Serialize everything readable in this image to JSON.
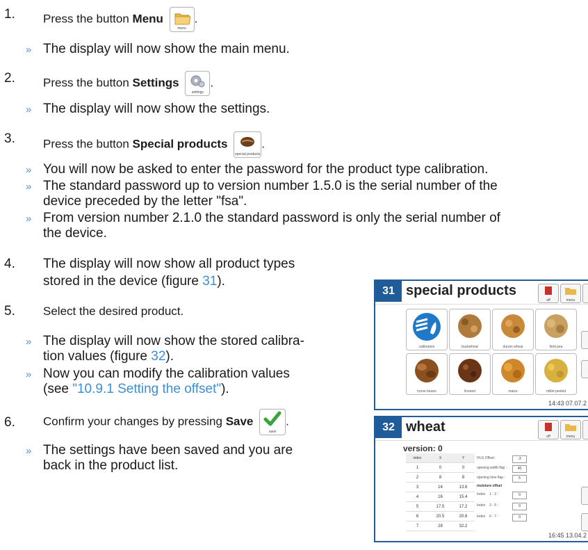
{
  "steps": [
    {
      "number": "1.",
      "text": "Press the button ",
      "bold": "Menu",
      "icon": "folder-icon",
      "icon_caption": "menu",
      "suffix": "."
    },
    {
      "number": "2.",
      "text": "Press the button ",
      "bold": "Settings",
      "icon": "gear-icon",
      "icon_caption": "settings",
      "suffix": "."
    },
    {
      "number": "3.",
      "text": "Press the button ",
      "bold": "Special products",
      "icon": "grain-icon",
      "icon_caption": "special products",
      "suffix": "."
    },
    {
      "number": "4.",
      "line1": "The display will now show all product types",
      "line2_a": "stored in the device (figure ",
      "line2_link": "31",
      "line2_b": ")."
    },
    {
      "number": "5.",
      "text": "Select the desired product."
    },
    {
      "number": "6.",
      "text": "Confirm your changes by pressing ",
      "bold": "Save",
      "icon": "checkmark-icon",
      "icon_caption": "save",
      "suffix": "."
    }
  ],
  "results": {
    "r1": "The display will now show the main menu.",
    "r2": "The display will now show the settings.",
    "r3a": "You will now be asked to enter the password for the product type calibration.",
    "r3b_1": "The standard password up to version number 1.5.0 is the serial number of the",
    "r3b_2": "device preceded by the letter \"fsa\".",
    "r3c_1": "From version number 2.1.0 the standard password is only the serial number of",
    "r3c_2": "the device.",
    "r5a_1": "The display will now show the stored calibra-",
    "r5a_2a": "tion values (figure ",
    "r5a_2link": "32",
    "r5a_2b": ").",
    "r5b_1": "Now you can modify the calibration values",
    "r5b_2a": "(see ",
    "r5b_2link": "\"10.9.1 Setting the offset\"",
    "r5b_2b": ").",
    "r6_1": "The settings have been saved and you are",
    "r6_2": "back in the product list.",
    "arrow": "»"
  },
  "figure31": {
    "number": "31",
    "title": "special products",
    "buttons": [
      {
        "caption": "off"
      },
      {
        "caption": "menu"
      }
    ],
    "tiles": [
      "calibration",
      "buckwheat",
      "durum wheat",
      "field pea",
      "horse beans",
      "linseed",
      "maize",
      "millet peeled"
    ],
    "clock": "14:43 07.07.2"
  },
  "figure32": {
    "number": "32",
    "title": "wheat",
    "buttons": [
      {
        "caption": "off"
      },
      {
        "caption": "menu"
      }
    ],
    "version": "version: 0",
    "table_headers": [
      "index",
      "X",
      "Y"
    ],
    "table_rows": [
      [
        "1",
        "0",
        "0"
      ],
      [
        "2",
        "8",
        "8"
      ],
      [
        "3",
        "14",
        "13.6"
      ],
      [
        "4",
        "16",
        "15.4"
      ],
      [
        "5",
        "17.5",
        "17.2"
      ],
      [
        "6",
        "20.5",
        "20.8"
      ],
      [
        "7",
        "28",
        "32.2"
      ]
    ],
    "params": [
      {
        "label": "HLG Offset :",
        "value": "-3"
      },
      {
        "label": "opening width flap :",
        "value": "40"
      },
      {
        "label": "opening time flap :",
        "value": "5"
      }
    ],
    "moisture_label": "moisture offset",
    "moisture": [
      {
        "label": "Index",
        "range": "1 - 2 :",
        "value": "0"
      },
      {
        "label": "Index",
        "range": "3 - 5 :",
        "value": "0"
      },
      {
        "label": "Index",
        "range": "6 - 7 :",
        "value": "0"
      }
    ],
    "clock": "16:45 13.04.2"
  }
}
